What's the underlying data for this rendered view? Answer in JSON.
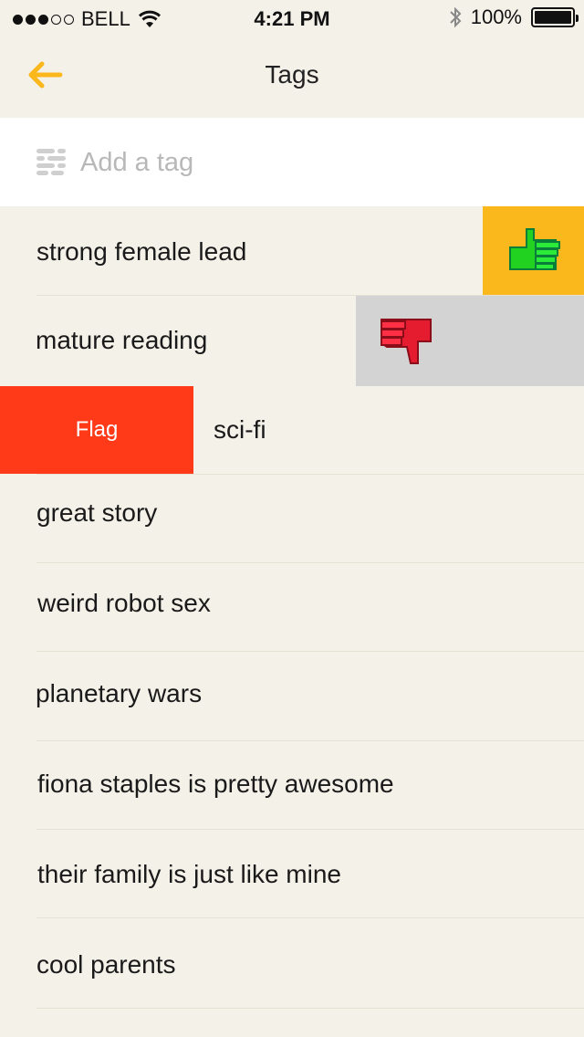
{
  "status_bar": {
    "carrier": "BELL",
    "time": "4:21 PM",
    "battery": "100%",
    "signal_bars_filled": 3,
    "signal_bars_total": 5
  },
  "nav": {
    "title": "Tags",
    "back_icon": "arrow-left-icon",
    "accent_color": "#fbb81d"
  },
  "add_tag": {
    "placeholder": "Add a tag",
    "icon": "tag-list-icon"
  },
  "actions": {
    "flag_label": "Flag",
    "like_icon": "thumbs-up-icon",
    "dislike_icon": "thumbs-down-icon",
    "like_color": "#fbb81d",
    "flag_color": "#ff3a19",
    "dislike_color": "#d3d3d3"
  },
  "tags": [
    {
      "label": "strong female lead"
    },
    {
      "label": "mature reading"
    },
    {
      "label": "sci-fi"
    },
    {
      "label": "great story"
    },
    {
      "label": "weird robot sex"
    },
    {
      "label": "planetary wars"
    },
    {
      "label": "fiona staples is pretty awesome"
    },
    {
      "label": "their family is just like mine"
    },
    {
      "label": "cool parents"
    }
  ]
}
